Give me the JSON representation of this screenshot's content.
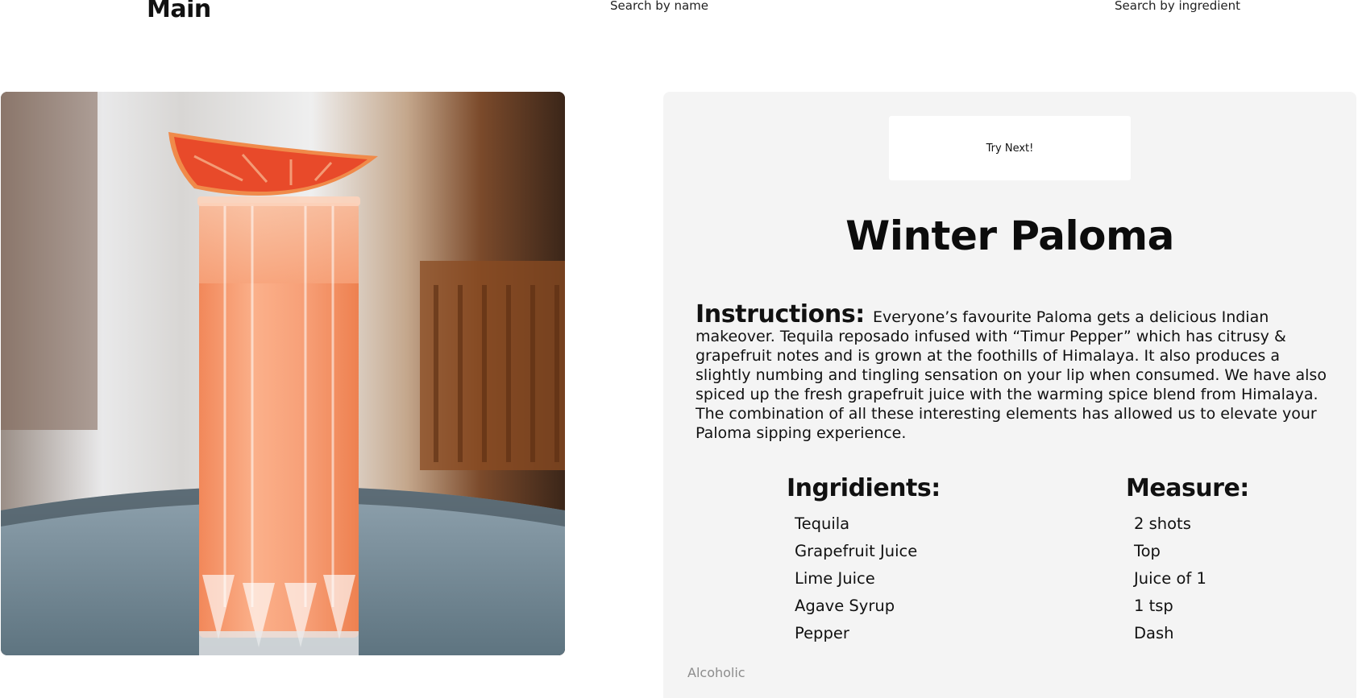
{
  "nav": {
    "main": "Main",
    "search_by_name": "Search by name",
    "search_by_ingredient": "Search by ingredient"
  },
  "drink": {
    "name": "Winter Paloma",
    "photo_icon": "cocktail-photo",
    "try_next_label": "Try Next!",
    "instructions_label": "Instructions:",
    "instructions": "Everyone’s favourite Paloma gets a delicious Indian makeover. Tequila reposado infused with “Timur Pepper” which has citrusy & grapefruit notes and is grown at the foothills of Himalaya. It also produces a slightly numbing and tingling sensation on your lip when consumed. We have also spiced up the fresh grapefruit juice with the warming spice blend from Himalaya. The combination of all these interesting elements has allowed us to elevate your Paloma sipping experience.",
    "ingredients_label": "Ingridients:",
    "measure_label": "Measure:",
    "ingredients": [
      "Tequila",
      "Grapefruit Juice",
      "Lime Juice",
      "Agave Syrup",
      "Pepper"
    ],
    "measures": [
      "2 shots",
      "Top",
      "Juice of 1",
      "1 tsp",
      "Dash"
    ],
    "category": "Alcoholic"
  },
  "colors": {
    "panel_bg": "#f4f4f4",
    "drink_orange": "#f79a6a",
    "category_text": "#8c8c8c"
  }
}
